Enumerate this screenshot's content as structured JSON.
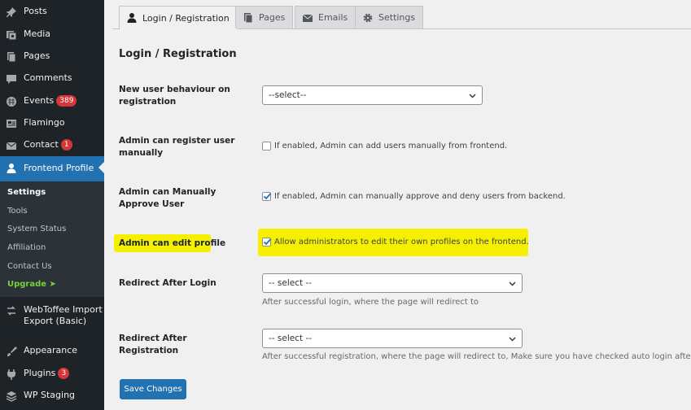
{
  "sidebar": {
    "items": [
      {
        "label": "Posts",
        "icon": "pin-icon"
      },
      {
        "label": "Media",
        "icon": "media-icon"
      },
      {
        "label": "Pages",
        "icon": "pages-icon"
      },
      {
        "label": "Comments",
        "icon": "comment-icon"
      },
      {
        "label": "Events",
        "icon": "calendar-icon",
        "badge": "389"
      },
      {
        "label": "Flamingo",
        "icon": "flamingo-icon"
      },
      {
        "label": "Contact",
        "icon": "mail-icon",
        "badge": "1"
      },
      {
        "label": "Frontend Profile",
        "icon": "user-icon"
      },
      {
        "label": "WebToffee Import",
        "label2": "Export (Basic)",
        "icon": "import-export-icon"
      },
      {
        "label": "Appearance",
        "icon": "brush-icon"
      },
      {
        "label": "Plugins",
        "icon": "plugin-icon",
        "badge": "3"
      },
      {
        "label": "WP Staging",
        "icon": "staging-icon"
      }
    ],
    "submenu": [
      "Settings",
      "Tools",
      "System Status",
      "Affiliation",
      "Contact Us",
      "Upgrade"
    ],
    "upgrade_arrow": "➤"
  },
  "tabs": [
    "Login / Registration",
    "Pages",
    "Emails",
    "Settings"
  ],
  "section_title": "Login / Registration",
  "rows": {
    "new_user": {
      "label": "New user behaviour on registration",
      "value": "--select--"
    },
    "admin_register": {
      "label": "Admin can register user manually",
      "text": "If enabled, Admin can add users manually from frontend.",
      "checked": false
    },
    "admin_approve": {
      "label": "Admin can Manually Approve User",
      "text": "If enabled, Admin can manually approve and deny users from backend.",
      "checked": true
    },
    "admin_edit": {
      "label": "Admin can edit profile",
      "text": "Allow administrators to edit their own profiles on the frontend.",
      "checked": true
    },
    "redirect_login": {
      "label": "Redirect After Login",
      "value": "-- select --",
      "help": "After successful login, where the page will redirect to"
    },
    "redirect_registration": {
      "label": "Redirect After Registration",
      "value": "-- select --",
      "help": "After successful registration, where the page will redirect to, Make sure you have checked auto login after re"
    }
  },
  "save_label": "Save Changes",
  "colors": {
    "accent": "#2271b1",
    "highlight": "#f5f000",
    "sidebar": "#1d2327",
    "badge": "#d63638",
    "upgrade": "#7ad03a"
  }
}
